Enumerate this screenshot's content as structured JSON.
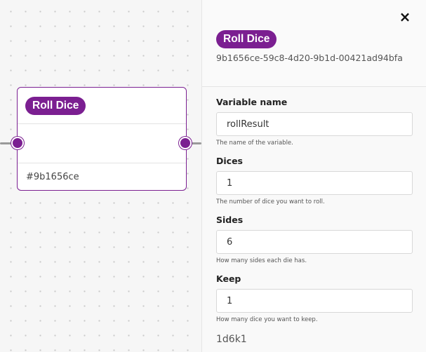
{
  "node": {
    "title": "Roll Dice",
    "short_id": "#9b1656ce"
  },
  "panel": {
    "title": "Roll Dice",
    "id": "9b1656ce-59c8-4d20-9b1d-00421ad94bfa",
    "close_icon": "×",
    "fields": [
      {
        "label": "Variable name",
        "value": "rollResult",
        "help": "The name of the variable."
      },
      {
        "label": "Dices",
        "value": "1",
        "help": "The number of dice you want to roll."
      },
      {
        "label": "Sides",
        "value": "6",
        "help": "How many sides each die has."
      },
      {
        "label": "Keep",
        "value": "1",
        "help": "How many dice you want to keep."
      }
    ],
    "summary": "1d6k1"
  },
  "colors": {
    "accent": "#7b1f91"
  }
}
